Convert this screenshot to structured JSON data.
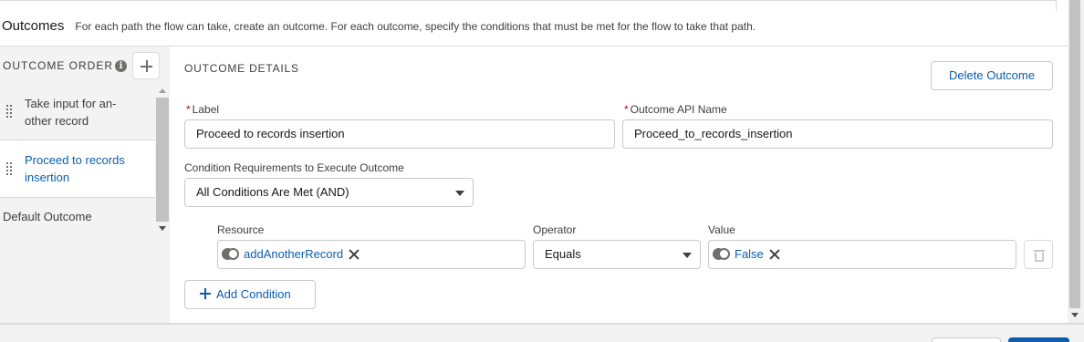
{
  "header": {
    "title": "Outcomes",
    "description": "For each path the flow can take, create an outcome. For each outcome, specify the conditions that must be met for the flow to take that path."
  },
  "sidebar": {
    "order_label": "OUTCOME ORDER",
    "info_icon": "info-icon",
    "add_icon": "plus-icon",
    "items": [
      {
        "label": "Take input for an-other record",
        "selected": false
      },
      {
        "label": "Proceed to records insertion",
        "selected": true
      },
      {
        "label": "Default Outcome",
        "selected": false
      }
    ]
  },
  "details": {
    "title": "OUTCOME DETAILS",
    "delete_label": "Delete Outcome",
    "label_field": {
      "label": "Label",
      "required": "*",
      "value": "Proceed to records insertion"
    },
    "api_field": {
      "label": "Outcome API Name",
      "required": "*",
      "value": "Proceed_to_records_insertion"
    },
    "condition_requirements": {
      "label": "Condition Requirements to Execute Outcome",
      "value": "All Conditions Are Met (AND)"
    },
    "condition": {
      "resource_label": "Resource",
      "resource_value": "addAnotherRecord",
      "operator_label": "Operator",
      "operator_value": "Equals",
      "value_label": "Value",
      "value_value": "False"
    },
    "add_condition_label": "Add Condition"
  },
  "colors": {
    "link": "#0b5cab",
    "required": "#ba0517",
    "sidebar_bg": "#f3f3f3",
    "border": "#c9c9c9"
  }
}
